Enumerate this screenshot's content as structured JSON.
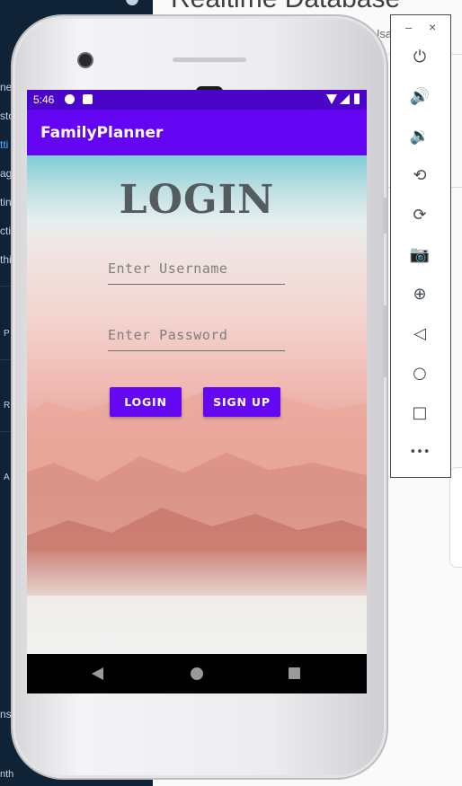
{
  "background_ide": {
    "left_snippets": [
      "ne",
      "sto",
      "tti",
      "ag",
      "tin",
      "cti",
      "thi",
      "P",
      "R",
      "A",
      "ns",
      "nth"
    ],
    "right_title": "Realtime Database",
    "right_usa": "Usa"
  },
  "emulator": {
    "minimize_label": "–",
    "close_label": "×",
    "tools": [
      {
        "name": "power",
        "glyph": "⏻"
      },
      {
        "name": "volume-up",
        "glyph": "🔊"
      },
      {
        "name": "volume-down",
        "glyph": "🔉"
      },
      {
        "name": "rotate-left",
        "glyph": "⟲"
      },
      {
        "name": "rotate-right",
        "glyph": "⟳"
      },
      {
        "name": "screenshot",
        "glyph": "📷"
      },
      {
        "name": "zoom",
        "glyph": "⊕"
      },
      {
        "name": "back",
        "glyph": "◁"
      },
      {
        "name": "home",
        "glyph": "○"
      },
      {
        "name": "overview",
        "glyph": "□"
      },
      {
        "name": "more",
        "glyph": "•••"
      }
    ]
  },
  "status_bar": {
    "time": "5:46"
  },
  "app_bar": {
    "title": "FamilyPlanner"
  },
  "login": {
    "heading": "LOGIN",
    "username_placeholder": "Enter Username",
    "password_placeholder": "Enter Password",
    "login_button": "LOGIN",
    "signup_button": "SIGN UP"
  },
  "colors": {
    "status_bar": "#4b05c9",
    "app_bar": "#6305f2",
    "button": "#6308f0",
    "ide_bg": "#0f2236"
  }
}
